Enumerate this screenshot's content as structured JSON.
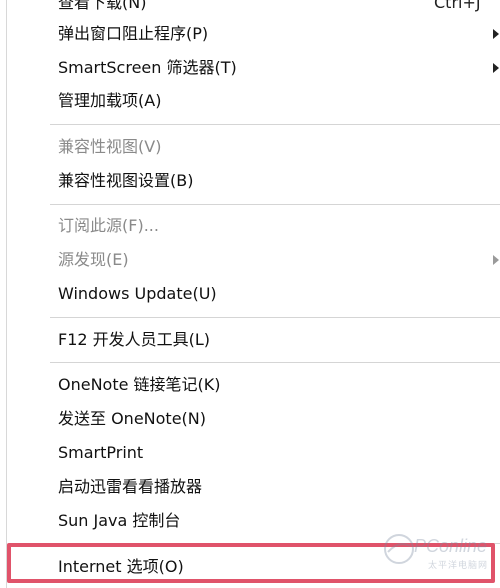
{
  "menu": {
    "items": [
      {
        "label": "查看下载(N)",
        "shortcut": "Ctrl+J",
        "disabled": false,
        "submenu": false
      },
      {
        "label": "弹出窗口阻止程序(P)",
        "shortcut": "",
        "disabled": false,
        "submenu": true
      },
      {
        "label": "SmartScreen 筛选器(T)",
        "shortcut": "",
        "disabled": false,
        "submenu": true
      },
      {
        "label": "管理加载项(A)",
        "shortcut": "",
        "disabled": false,
        "submenu": false
      },
      {
        "label": "兼容性视图(V)",
        "shortcut": "",
        "disabled": true,
        "submenu": false
      },
      {
        "label": "兼容性视图设置(B)",
        "shortcut": "",
        "disabled": false,
        "submenu": false
      },
      {
        "label": "订阅此源(F)...",
        "shortcut": "",
        "disabled": true,
        "submenu": false
      },
      {
        "label": "源发现(E)",
        "shortcut": "",
        "disabled": true,
        "submenu": true
      },
      {
        "label": "Windows Update(U)",
        "shortcut": "",
        "disabled": false,
        "submenu": false
      },
      {
        "label": "F12 开发人员工具(L)",
        "shortcut": "",
        "disabled": false,
        "submenu": false
      },
      {
        "label": "OneNote 链接笔记(K)",
        "shortcut": "",
        "disabled": false,
        "submenu": false
      },
      {
        "label": "发送至 OneNote(N)",
        "shortcut": "",
        "disabled": false,
        "submenu": false
      },
      {
        "label": "SmartPrint",
        "shortcut": "",
        "disabled": false,
        "submenu": false
      },
      {
        "label": "启动迅雷看看播放器",
        "shortcut": "",
        "disabled": false,
        "submenu": false
      },
      {
        "label": "Sun Java 控制台",
        "shortcut": "",
        "disabled": false,
        "submenu": false
      },
      {
        "label": "Internet 选项(O)",
        "shortcut": "",
        "disabled": false,
        "submenu": false,
        "highlighted": true
      }
    ]
  },
  "watermark": {
    "text": "PConline",
    "sub": "太平洋电脑网"
  },
  "colors": {
    "highlight_border": "#e0536a",
    "disabled_text": "#8a8a8a",
    "separator": "#d5d5d5"
  }
}
